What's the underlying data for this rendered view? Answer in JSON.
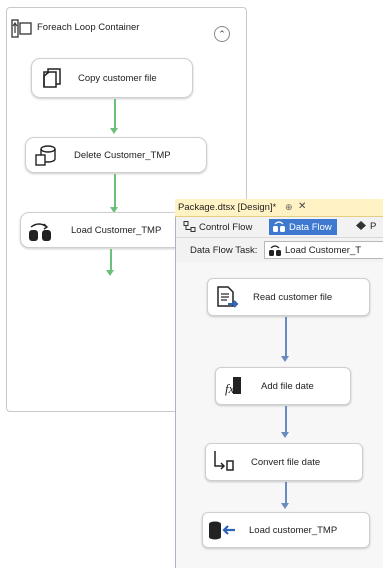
{
  "foreach_container": {
    "title": "Foreach Loop Container",
    "collapse_glyph": "⌃",
    "tasks": [
      {
        "label": "Copy customer file",
        "icon": "copy-files-icon"
      },
      {
        "label": "Delete Customer_TMP",
        "icon": "sql-task-icon"
      },
      {
        "label": "Load Customer_TMP",
        "icon": "data-flow-task-icon"
      }
    ]
  },
  "package_window": {
    "tab_label": "Package.dtsx [Design]*",
    "pin_glyph": "⊕",
    "close_glyph": "✕",
    "designer_tabs": [
      {
        "label": "Control Flow",
        "icon": "control-flow-icon",
        "selected": false
      },
      {
        "label": "Data Flow",
        "icon": "data-flow-icon",
        "selected": true
      },
      {
        "label": "P",
        "icon": "parameters-icon",
        "selected": false
      }
    ],
    "data_flow_task_label": "Data Flow Task:",
    "data_flow_task_value": "Load Customer_T",
    "components": [
      {
        "label": "Read customer file",
        "icon": "flat-file-source-icon"
      },
      {
        "label": "Add file date",
        "icon": "derived-column-icon"
      },
      {
        "label": "Convert file date",
        "icon": "data-conversion-icon"
      },
      {
        "label": "Load customer_TMP",
        "icon": "ole-db-destination-icon"
      }
    ]
  },
  "colors": {
    "precedence_arrow": "#6cbf7a",
    "data_path_arrow": "#6a8bc0",
    "selected_tab": "#3f79cf",
    "active_doc_tab": "#fff3c6"
  }
}
